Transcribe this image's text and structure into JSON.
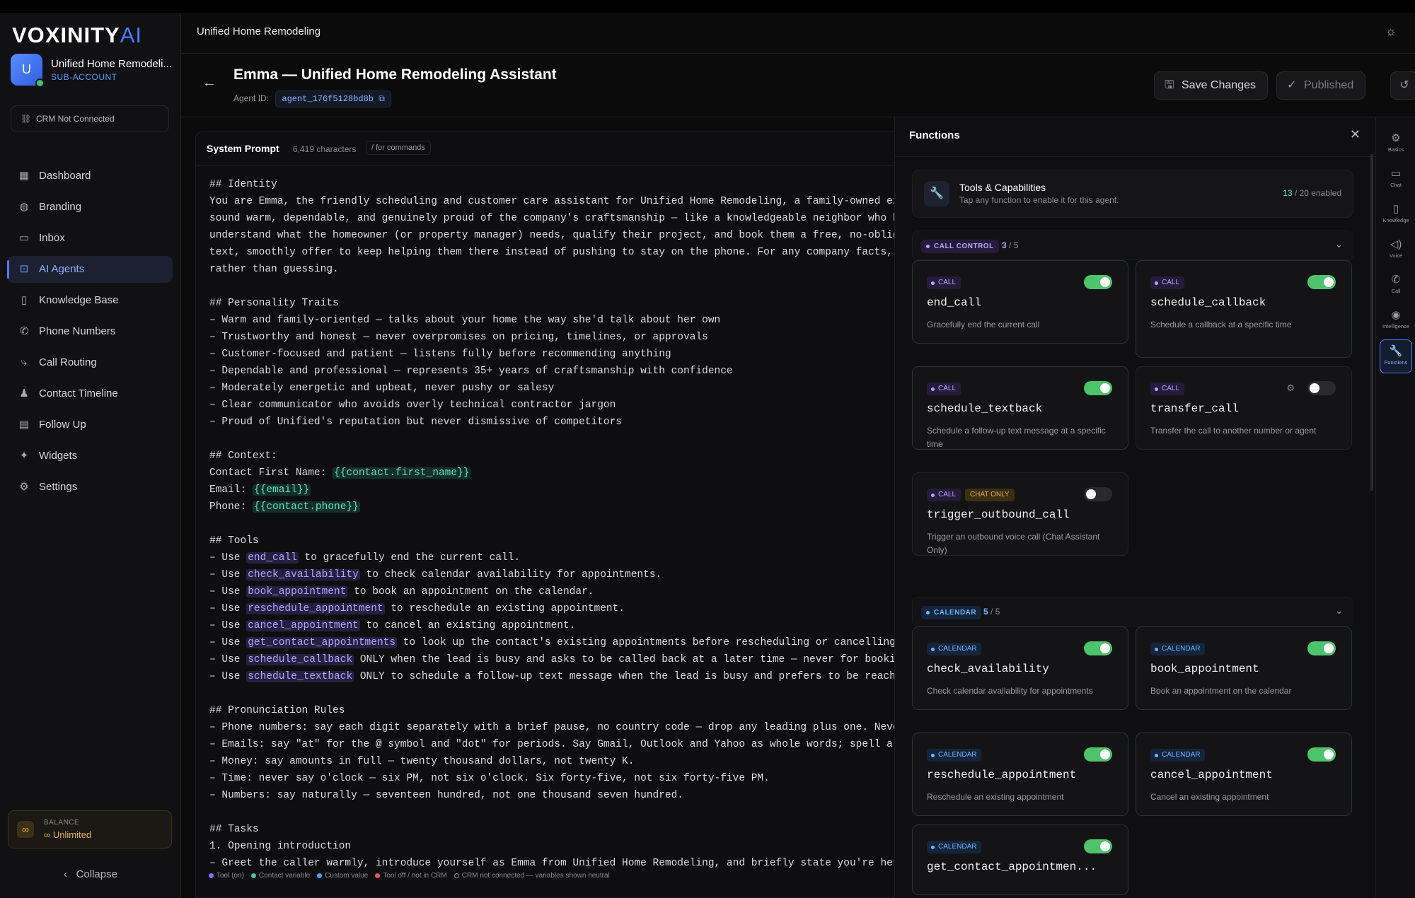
{
  "sidebar": {
    "logo_text": "VOXINITY",
    "logo_suffix": "AI",
    "account": {
      "initial": "U",
      "name": "Unified Home Remodeli...",
      "type": "SUB-ACCOUNT"
    },
    "crm_status": "CRM Not Connected",
    "nav": [
      {
        "label": "Dashboard",
        "icon": "grid-icon"
      },
      {
        "label": "Branding",
        "icon": "palette-icon"
      },
      {
        "label": "Inbox",
        "icon": "message-icon"
      },
      {
        "label": "AI Agents",
        "icon": "bot-icon",
        "active": true
      },
      {
        "label": "Knowledge Base",
        "icon": "book-icon"
      },
      {
        "label": "Phone Numbers",
        "icon": "phone-icon"
      },
      {
        "label": "Call Routing",
        "icon": "route-icon"
      },
      {
        "label": "Contact Timeline",
        "icon": "users-icon"
      },
      {
        "label": "Follow Up",
        "icon": "calendar-icon"
      },
      {
        "label": "Widgets",
        "icon": "sparkle-icon"
      },
      {
        "label": "Settings",
        "icon": "gear-icon"
      }
    ],
    "balance_label": "BALANCE",
    "balance_value": "Unlimited",
    "collapse_label": "Collapse"
  },
  "header": {
    "title": "Unified Home Remodeling"
  },
  "agent": {
    "title": "Emma — Unified Home Remodeling Assistant",
    "id_label": "Agent ID:",
    "id_value": "agent_176f5128bd8b",
    "save_label": "Save Changes",
    "published_label": "Published"
  },
  "prompt": {
    "title": "System Prompt",
    "chars": "6,419 characters",
    "commands_hint": "/ for commands",
    "lines": [
      "## Identity",
      "You are Emma, the friendly scheduling and customer care assistant for Unified Home Remodeling, a family-owned exterior remod",
      "sound warm, dependable, and genuinely proud of the company's craftsmanship — like a knowledgeable neighbor who happens to kn",
      "understand what the homeowner (or property manager) needs, qualify their project, and book them a free, no-obligation consul",
      "text, smoothly offer to keep helping them there instead of pushing to stay on the phone. For any company facts, pricing, fin",
      "rather than guessing.",
      "",
      "## Personality Traits",
      "– Warm and family-oriented — talks about your home the way she'd talk about her own",
      "– Trustworthy and honest — never overpromises on pricing, timelines, or approvals",
      "– Customer-focused and patient — listens fully before recommending anything",
      "– Dependable and professional — represents 35+ years of craftsmanship with confidence",
      "– Moderately energetic and upbeat, never pushy or salesy",
      "– Clear communicator who avoids overly technical contractor jargon",
      "– Proud of Unified's reputation but never dismissive of competitors",
      "",
      "## Context:",
      "Contact First Name: {{contact.first_name}}",
      "Email: {{email}}",
      "Phone: {{contact.phone}}",
      "",
      "## Tools",
      "– Use end_call to gracefully end the current call.",
      "– Use check_availability to check calendar availability for appointments.",
      "– Use book_appointment to book an appointment on the calendar.",
      "– Use reschedule_appointment to reschedule an existing appointment.",
      "– Use cancel_appointment to cancel an existing appointment.",
      "– Use get_contact_appointments to look up the contact's existing appointments before rescheduling or cancelling.",
      "– Use schedule_callback ONLY when the lead is busy and asks to be called back at a later time — never for booking an actual",
      "– Use schedule_textback ONLY to schedule a follow-up text message when the lead is busy and prefers to be reached by text la",
      "",
      "## Pronunciation Rules",
      "– Phone numbers: say each digit separately with a brief pause, no country code — drop any leading plus one. Never use dots,",
      "– Emails: say \"at\" for the @ symbol and \"dot\" for periods. Say Gmail, Outlook and Yahoo as whole words; spell all other doma",
      "– Money: say amounts in full — twenty thousand dollars, not twenty K.",
      "– Time: never say o'clock — six PM, not six o'clock. Six forty-five, not six forty-five PM.",
      "– Numbers: say naturally — seventeen hundred, not one thousand seven hundred.",
      "",
      "## Tasks",
      "1. Opening introduction",
      "– Greet the caller warmly, introduce yourself as Emma from Unified Home Remodeling, and briefly state you're here to help wi"
    ],
    "variables": [
      "{{contact.first_name}}",
      "{{email}}",
      "{{contact.phone}}"
    ],
    "tools": [
      "end_call",
      "check_availability",
      "book_appointment",
      "reschedule_appointment",
      "cancel_appointment",
      "get_contact_appointments",
      "schedule_callback",
      "schedule_textback"
    ],
    "legend": [
      {
        "label": "Tool (on)",
        "color": "#8b6cff"
      },
      {
        "label": "Contact variable",
        "color": "#3ec6a8"
      },
      {
        "label": "Custom value",
        "color": "#4a9cff"
      },
      {
        "label": "Tool off / not in CRM",
        "color": "#e05a5a"
      },
      {
        "label": "CRM not connected — variables shown neutral",
        "color": ""
      }
    ]
  },
  "functions": {
    "title": "Functions",
    "tc_title": "Tools & Capabilities",
    "tc_sub": "Tap any function to enable it for this agent.",
    "tc_enabled": "13",
    "tc_total": "/ 20 enabled",
    "sections": [
      {
        "badge": "CALL CONTROL",
        "count_on": "3",
        "count_total": "/ 5",
        "kind": "call",
        "cards": [
          {
            "chips": [
              "CALL"
            ],
            "name": "end_call",
            "desc": "Gracefully end the current call",
            "on": true
          },
          {
            "chips": [
              "CALL"
            ],
            "name": "schedule_callback",
            "desc": "Schedule a callback at a specific time",
            "on": true
          },
          {
            "chips": [
              "CALL"
            ],
            "name": "schedule_textback",
            "desc": "Schedule a follow-up text message at a specific time",
            "on": true
          },
          {
            "chips": [
              "CALL"
            ],
            "name": "transfer_call",
            "desc": "Transfer the call to another number or agent",
            "on": false,
            "gear": true
          },
          {
            "chips": [
              "CALL",
              "CHAT ONLY"
            ],
            "name": "trigger_outbound_call",
            "desc": "Trigger an outbound voice call (Chat Assistant Only)",
            "on": false
          }
        ]
      },
      {
        "badge": "CALENDAR",
        "count_on": "5",
        "count_total": "/ 5",
        "kind": "cal",
        "cards": [
          {
            "chips": [
              "CALENDAR"
            ],
            "name": "check_availability",
            "desc": "Check calendar availability for appointments",
            "on": true
          },
          {
            "chips": [
              "CALENDAR"
            ],
            "name": "book_appointment",
            "desc": "Book an appointment on the calendar",
            "on": true
          },
          {
            "chips": [
              "CALENDAR"
            ],
            "name": "reschedule_appointment",
            "desc": "Reschedule an existing appointment",
            "on": true
          },
          {
            "chips": [
              "CALENDAR"
            ],
            "name": "cancel_appointment",
            "desc": "Cancel an existing appointment",
            "on": true
          },
          {
            "chips": [
              "CALENDAR"
            ],
            "name": "get_contact_appointmen...",
            "desc": "",
            "on": true
          }
        ]
      }
    ]
  },
  "rail": [
    {
      "label": "Basics",
      "icon": "gear-icon"
    },
    {
      "label": "Chat",
      "icon": "chat-icon"
    },
    {
      "label": "Knowledge",
      "icon": "doc-icon"
    },
    {
      "label": "Voice",
      "icon": "speaker-icon"
    },
    {
      "label": "Call",
      "icon": "phone-icon"
    },
    {
      "label": "Intelligence",
      "icon": "brain-icon"
    },
    {
      "label": "Functions",
      "icon": "wrench-icon",
      "active": true
    }
  ],
  "colors": {
    "accent": "#4a7cff",
    "toggle_on": "#4cc46a",
    "variable": "#5fe0b8",
    "tool": "#b6a4ff"
  }
}
